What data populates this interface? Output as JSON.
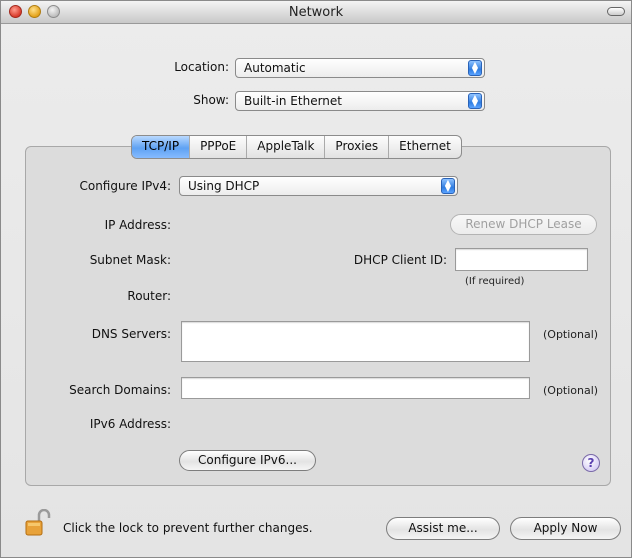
{
  "window": {
    "title": "Network"
  },
  "location": {
    "label": "Location:",
    "value": "Automatic"
  },
  "show": {
    "label": "Show:",
    "value": "Built-in Ethernet"
  },
  "tabs": [
    "TCP/IP",
    "PPPoE",
    "AppleTalk",
    "Proxies",
    "Ethernet"
  ],
  "tcpip": {
    "configure_label": "Configure IPv4:",
    "configure_value": "Using DHCP",
    "ip_address_label": "IP Address:",
    "renew_button": "Renew DHCP Lease",
    "subnet_label": "Subnet Mask:",
    "dhcp_client_label": "DHCP Client ID:",
    "dhcp_client_value": "",
    "if_required": "(If required)",
    "router_label": "Router:",
    "dns_label": "DNS Servers:",
    "dns_value": "",
    "dns_optional": "(Optional)",
    "search_label": "Search Domains:",
    "search_value": "",
    "search_optional": "(Optional)",
    "ipv6_label": "IPv6 Address:",
    "configure_ipv6_button": "Configure IPv6..."
  },
  "footer": {
    "lock_text": "Click the lock to prevent further changes.",
    "assist_button": "Assist me...",
    "apply_button": "Apply Now"
  },
  "icons": {
    "lock": "lock-icon",
    "help": "help-icon",
    "popup_arrows": "chevron-updown-icon"
  }
}
